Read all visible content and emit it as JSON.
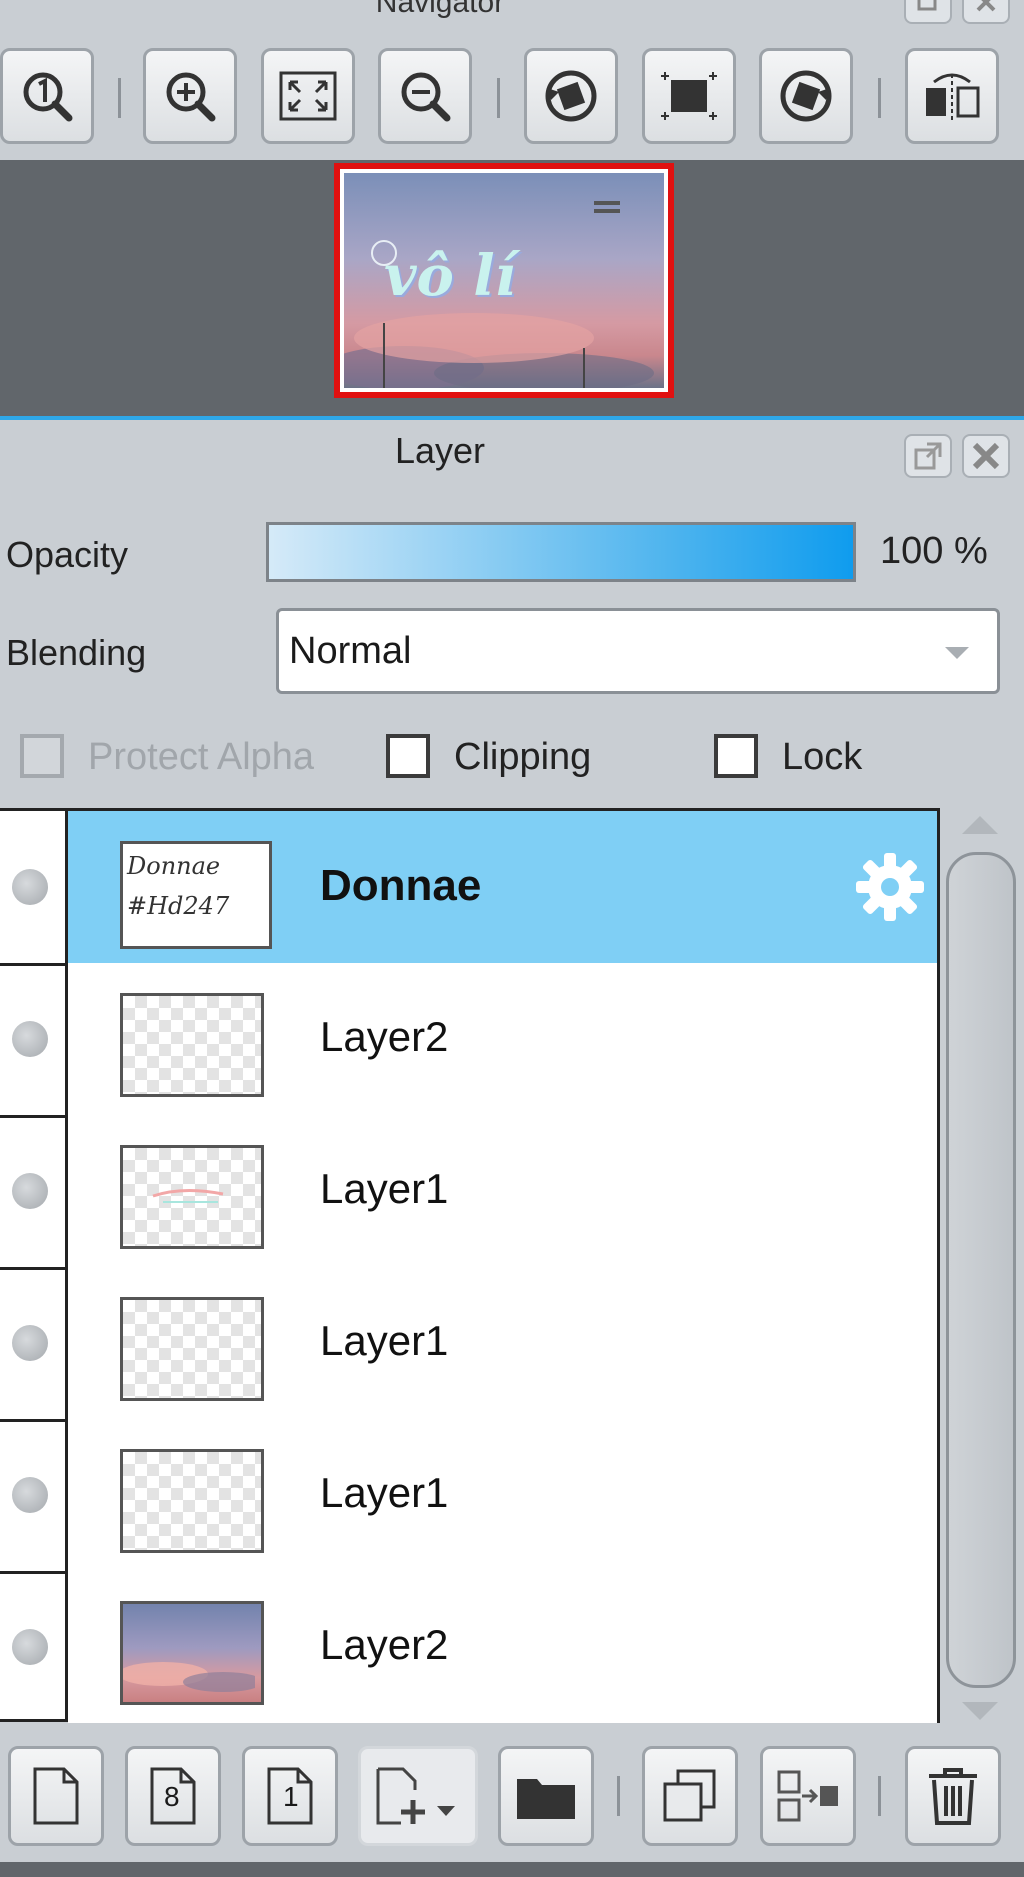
{
  "navigator": {
    "title": "Navigator",
    "toolbar": [
      {
        "name": "zoom-reset-button",
        "icon": "one-to-one-magnifier-icon"
      },
      {
        "name": "zoom-in-button",
        "icon": "zoom-in-icon"
      },
      {
        "name": "fit-to-window-button",
        "icon": "fit-window-icon"
      },
      {
        "name": "zoom-out-button",
        "icon": "zoom-out-icon"
      },
      {
        "name": "rotate-left-button",
        "icon": "rotate-left-icon"
      },
      {
        "name": "reset-rotation-button",
        "icon": "reset-view-icon"
      },
      {
        "name": "rotate-right-button",
        "icon": "rotate-right-icon"
      },
      {
        "name": "flip-horizontal-button",
        "icon": "flip-icon"
      }
    ],
    "preview_text": "vô lí"
  },
  "layer_panel": {
    "title": "Layer",
    "opacity_label": "Opacity",
    "opacity_value": "100 %",
    "opacity_fraction": 1.0,
    "blending_label": "Blending",
    "blending_value": "Normal",
    "protect_alpha_label": "Protect Alpha",
    "clipping_label": "Clipping",
    "lock_label": "Lock"
  },
  "layers": [
    {
      "name": "Donnae",
      "selected": true,
      "thumb": "text",
      "thumb_text": [
        "Donnae",
        "#Hd247"
      ]
    },
    {
      "name": "Layer2",
      "selected": false,
      "thumb": "transparent"
    },
    {
      "name": "Layer1",
      "selected": false,
      "thumb": "transparent"
    },
    {
      "name": "Layer1",
      "selected": false,
      "thumb": "transparent"
    },
    {
      "name": "Layer1",
      "selected": false,
      "thumb": "transparent"
    },
    {
      "name": "Layer2",
      "selected": false,
      "thumb": "sky"
    }
  ],
  "bottom_toolbar": [
    {
      "name": "new-layer-button",
      "icon": "new-page-icon"
    },
    {
      "name": "new-8bit-layer-button",
      "icon": "page-8-icon",
      "text": "8"
    },
    {
      "name": "new-1bit-layer-button",
      "icon": "page-1-icon",
      "text": "1"
    },
    {
      "name": "add-layer-menu-button",
      "icon": "add-page-dropdown-icon"
    },
    {
      "name": "new-folder-button",
      "icon": "folder-icon"
    },
    {
      "name": "duplicate-layer-button",
      "icon": "duplicate-icon"
    },
    {
      "name": "merge-down-button",
      "icon": "merge-icon"
    },
    {
      "name": "delete-layer-button",
      "icon": "trash-icon"
    }
  ],
  "colors": {
    "selected_row": "#7fcff5",
    "accent": "#2ea7e8",
    "preview_border": "#e01010"
  }
}
